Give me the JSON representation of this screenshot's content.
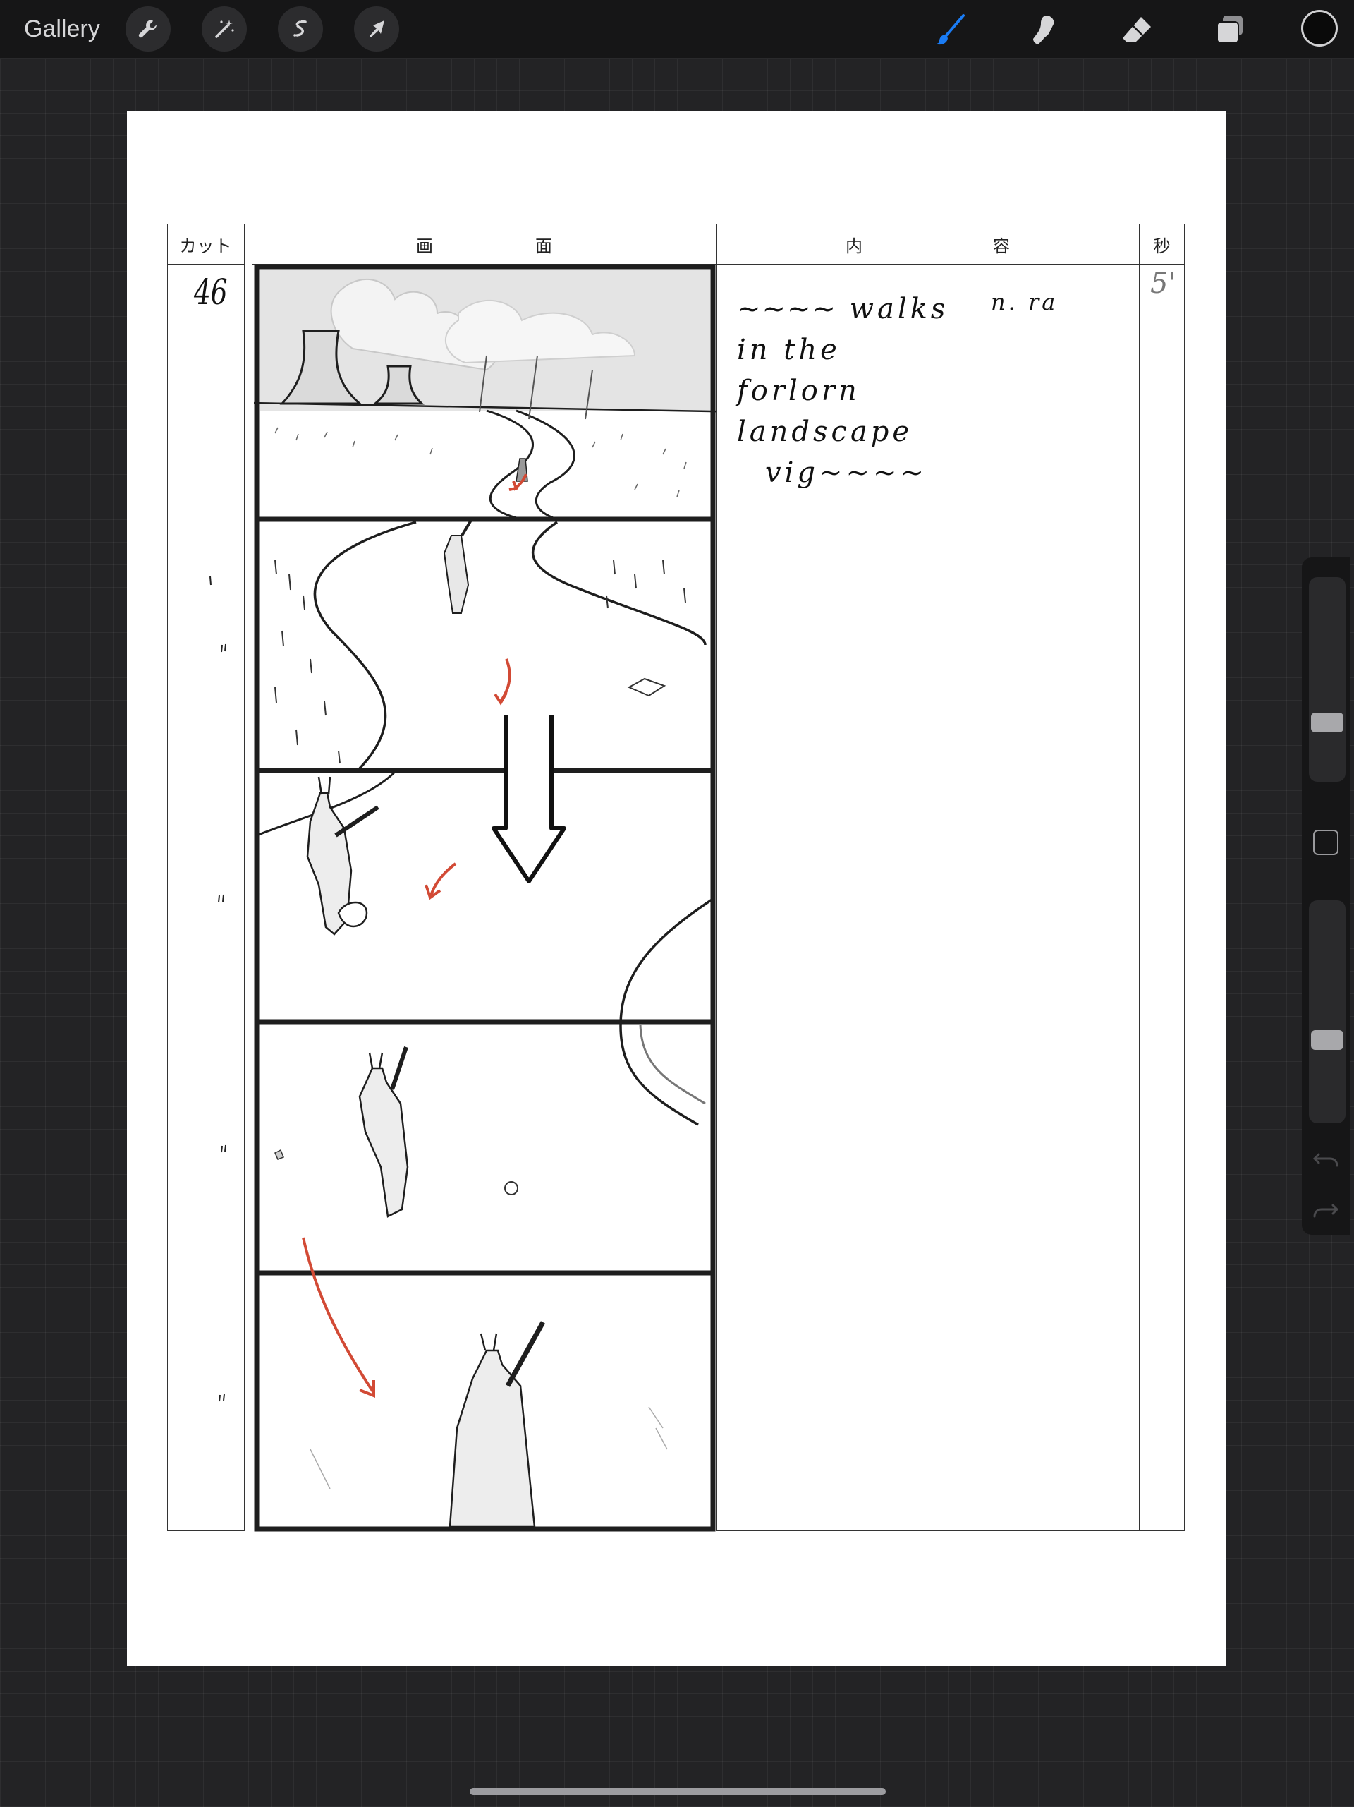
{
  "toolbar": {
    "gallery_label": "Gallery",
    "left_tools": [
      {
        "name": "actions",
        "icon": "wrench-icon"
      },
      {
        "name": "adjustments",
        "icon": "magic-wand-icon"
      },
      {
        "name": "selection",
        "icon": "selection-s-icon"
      },
      {
        "name": "transform",
        "icon": "arrow-cursor-icon"
      }
    ],
    "right_tools": [
      {
        "name": "brush",
        "icon": "brush-icon",
        "active": true
      },
      {
        "name": "smudge",
        "icon": "smudge-icon",
        "active": false
      },
      {
        "name": "eraser",
        "icon": "eraser-icon",
        "active": false
      },
      {
        "name": "layers",
        "icon": "layers-icon",
        "active": false
      }
    ],
    "active_color": "#0a0a0a",
    "accent_color": "#1a7cf5"
  },
  "storyboard": {
    "headers": {
      "cut": "カット",
      "picture_1": "画",
      "picture_2": "面",
      "content_1": "内",
      "content_2": "容",
      "seconds": "秒"
    },
    "cut_number": "46",
    "seconds_value": "5'",
    "action_text": [
      "walks",
      "in the forlorn",
      "landscape"
    ],
    "dialogue_text": "n. ra",
    "panel_count": 5
  },
  "sidebar": {
    "brush_size_level": 0.66,
    "opacity_level": 0.37,
    "icons": [
      "modify-square-icon",
      "undo-icon",
      "redo-icon"
    ]
  }
}
